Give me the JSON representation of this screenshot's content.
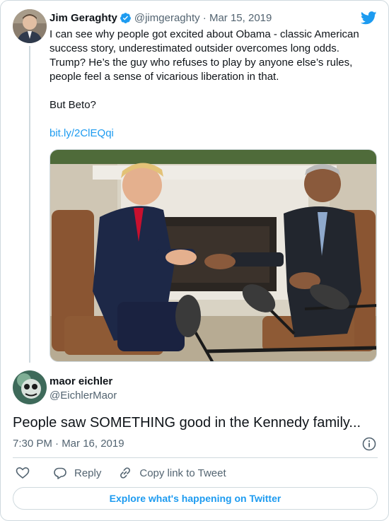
{
  "parent_tweet": {
    "author_name": "Jim Geraghty",
    "handle_date": "@jimgeraghty · Mar 15, 2019",
    "text": "I can see why people got excited about Obama - classic American success story, underestimated outsider overcomes long odds. Trump? He’s the guy who refuses to play by anyone else’s rules, people feel a sense of vicarious liberation in that.\n\nBut Beto?",
    "link": "bit.ly/2ClEQqi"
  },
  "reply_tweet": {
    "author_name": "maor eichler",
    "handle": "@EichlerMaor",
    "text": "People saw SOMETHING good in the Kennedy family...",
    "timestamp": "7:30 PM · Mar 16, 2019"
  },
  "actions": {
    "reply_label": "Reply",
    "copy_link_label": "Copy link to Tweet"
  },
  "explore_button": "Explore what's happening on Twitter",
  "icons": [
    "verified-icon",
    "twitter-logo-icon",
    "info-icon",
    "heart-icon",
    "reply-icon",
    "link-icon"
  ],
  "colors": {
    "accent": "#1d9bf0",
    "text_primary": "#0f1419",
    "text_secondary": "#536471",
    "border": "#cfd9de"
  }
}
